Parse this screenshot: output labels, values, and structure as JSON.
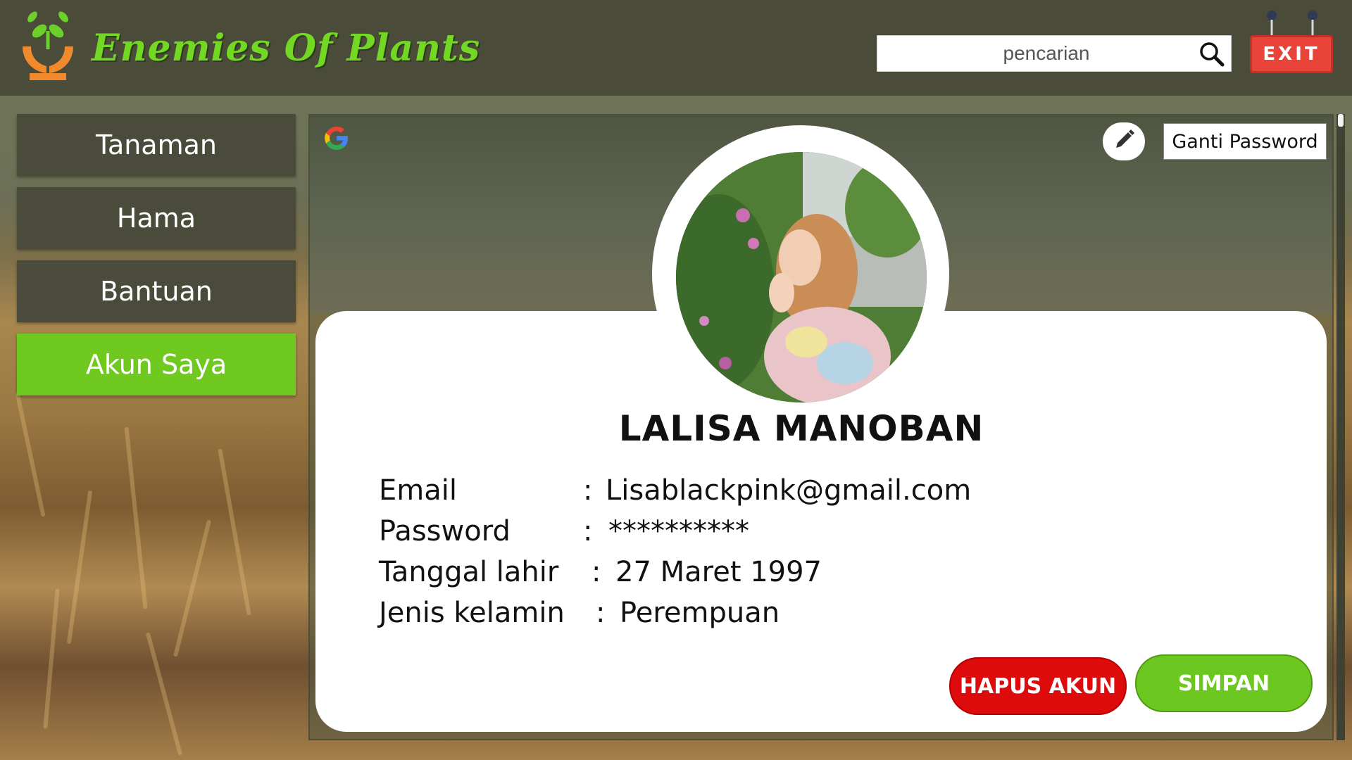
{
  "app": {
    "brand": "Enemies Of Plants",
    "brand_color": "#73d823",
    "header_color": "#4b4b3a"
  },
  "search": {
    "placeholder": "pencarian",
    "icon": "magnifier-icon"
  },
  "exit_button": {
    "label": "EXIT",
    "color": "#e8443a"
  },
  "sidebar": {
    "items": [
      {
        "label": "Tanaman",
        "active": false
      },
      {
        "label": "Hama",
        "active": false
      },
      {
        "label": "Bantuan",
        "active": false
      },
      {
        "label": "Akun Saya",
        "active": true
      }
    ],
    "active_color": "#6fc91e"
  },
  "profile": {
    "change_password_label": "Ganti Password",
    "name": "LALISA MANOBAN",
    "fields": [
      {
        "label": "Email",
        "value": "Lisablackpink@gmail.com"
      },
      {
        "label": "Password",
        "value": "**********"
      },
      {
        "label": "Tanggal lahir",
        "value": "27 Maret 1997"
      },
      {
        "label": "Jenis kelamin",
        "value": "Perempuan"
      }
    ],
    "separator": ":"
  },
  "actions": {
    "delete_label": "HAPUS AKUN",
    "delete_color": "#dd0b0b",
    "save_label": "SIMPAN",
    "save_color": "#6cc820"
  }
}
